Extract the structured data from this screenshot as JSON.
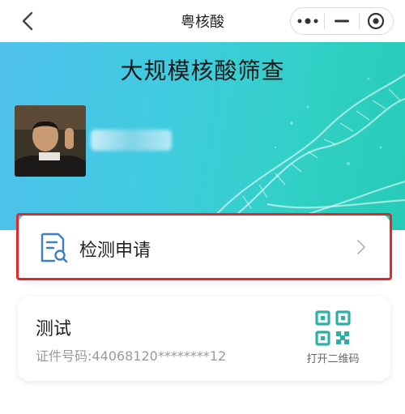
{
  "navbar": {
    "title": "粤核酸"
  },
  "hero": {
    "title": "大规模核酸筛查"
  },
  "apply": {
    "label": "检测申请"
  },
  "record": {
    "name": "测试",
    "id_label": "证件号码:",
    "id_value": "44068120********12",
    "qr_label": "打开二维码"
  },
  "colors": {
    "accent": "#2fb0a6",
    "highlight_border": "#e02a2a",
    "apply_icon": "#3f7fbf"
  }
}
